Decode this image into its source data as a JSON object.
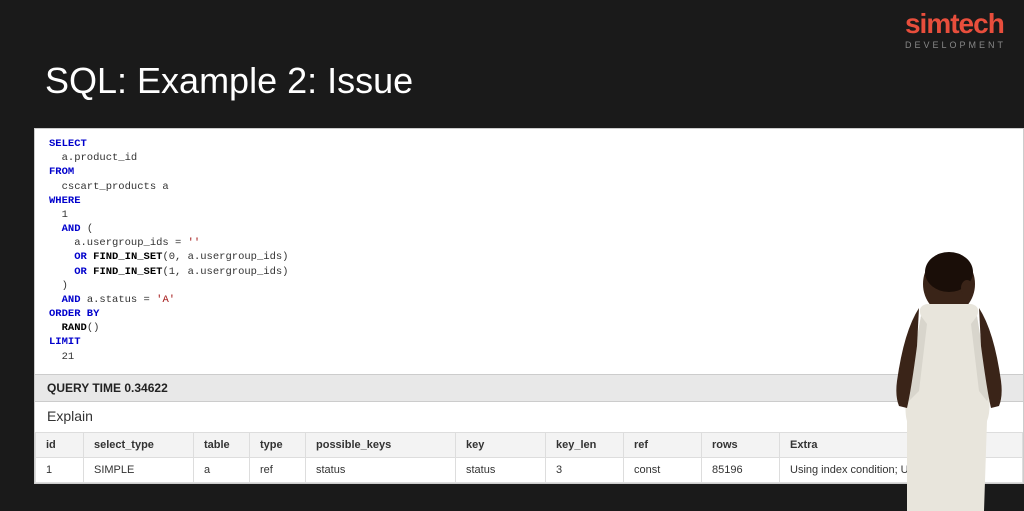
{
  "logo": {
    "brand": "simtech",
    "sub": "DEVELOPMENT"
  },
  "title": "SQL: Example 2: Issue",
  "sql": {
    "select_kw": "SELECT",
    "select_cols": "  a.product_id",
    "from_kw": "FROM",
    "from_table": "  cscart_products a",
    "where_kw": "WHERE",
    "where_1": "  1",
    "and_kw": "AND",
    "paren_open": "(",
    "cond_eq": "    a.usergroup_ids = ",
    "empty_str": "''",
    "or_kw": "OR",
    "find_in_set": "FIND_IN_SET",
    "fis0_open": "(0, a.usergroup_ids)",
    "fis1_open": "(1, a.usergroup_ids)",
    "paren_close": "  )",
    "status_cond_pre": " a.status = ",
    "status_val": "'A'",
    "orderby_kw": "ORDER BY",
    "rand_fn": "RAND",
    "rand_paren": "()",
    "limit_kw": "LIMIT",
    "limit_n": "  21"
  },
  "query_time": {
    "label": "QUERY TIME",
    "value": "0.34622"
  },
  "explain_label": "Explain",
  "explain": {
    "headers": {
      "id": "id",
      "select_type": "select_type",
      "table": "table",
      "type": "type",
      "possible_keys": "possible_keys",
      "key": "key",
      "key_len": "key_len",
      "ref": "ref",
      "rows": "rows",
      "extra": "Extra"
    },
    "row": {
      "id": "1",
      "select_type": "SIMPLE",
      "table": "a",
      "type": "ref",
      "possible_keys": "status",
      "key": "status",
      "key_len": "3",
      "ref": "const",
      "rows": "85196",
      "extra": "Using index condition; Using where"
    }
  }
}
